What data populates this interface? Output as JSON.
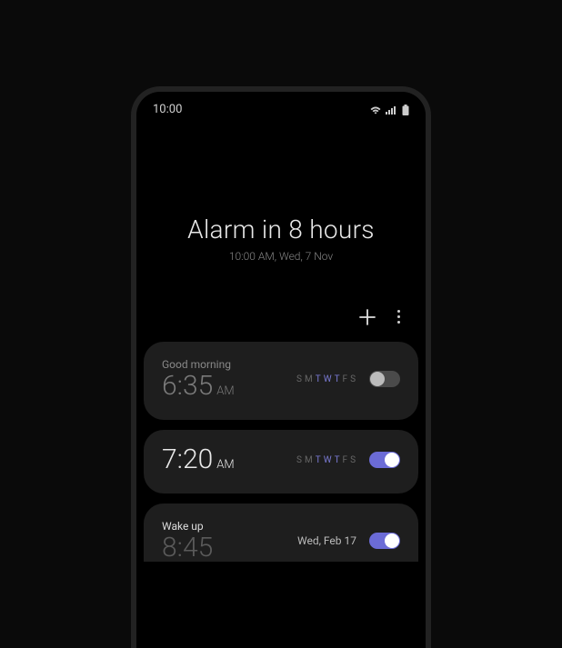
{
  "statusBar": {
    "time": "10:00"
  },
  "header": {
    "title": "Alarm in 8 hours",
    "subtitle": "10:00 AM, Wed, 7 Nov"
  },
  "days": {
    "labels": [
      "S",
      "M",
      "T",
      "W",
      "T",
      "F",
      "S"
    ]
  },
  "alarms": [
    {
      "label": "Good morning",
      "time": "6:35",
      "period": "AM",
      "enabled": false,
      "activeDays": [
        2,
        3,
        4
      ]
    },
    {
      "label": "",
      "time": "7:20",
      "period": "AM",
      "enabled": true,
      "activeDays": [
        2,
        3,
        4
      ]
    },
    {
      "label": "Wake up",
      "time": "8:45",
      "period": "",
      "enabled": true,
      "date": "Wed, Feb 17"
    }
  ]
}
